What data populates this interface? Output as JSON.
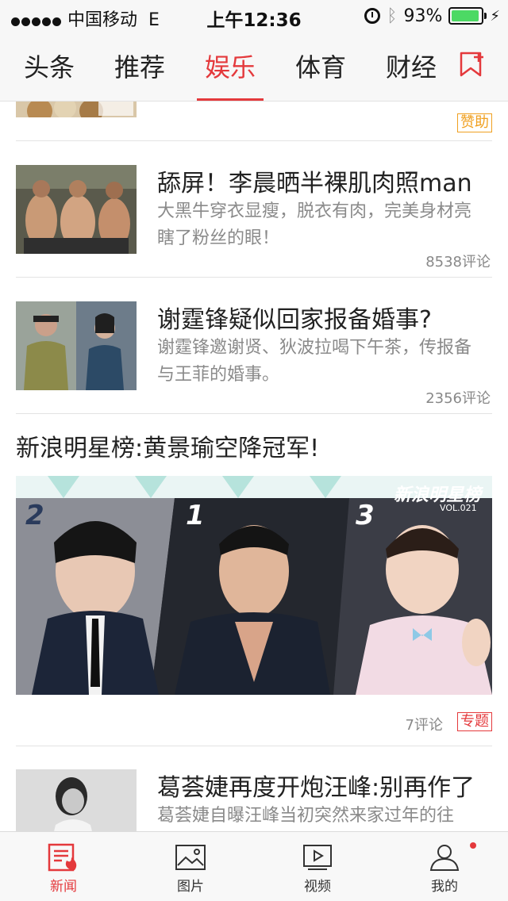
{
  "status_bar": {
    "carrier": "中国移动",
    "network": "E",
    "time": "上午12:36",
    "battery_percent": "93%",
    "battery_level": 0.93,
    "battery_color": "#4cd964"
  },
  "category_tabs": {
    "items": [
      {
        "label": "头条"
      },
      {
        "label": "推荐"
      },
      {
        "label": "娱乐"
      },
      {
        "label": "体育"
      },
      {
        "label": "财经"
      }
    ],
    "active": "娱乐",
    "accent": "#e4393c"
  },
  "feed": {
    "ad_item": {
      "tag": "赞助"
    },
    "news": [
      {
        "title": "舔屏！李晨晒半裸肌肉照man",
        "desc": "大黑牛穿衣显瘦，脱衣有肉，完美身材亮瞎了粉丝的眼！",
        "comments": "8538评论"
      },
      {
        "title": "谢霆锋疑似回家报备婚事?",
        "desc": "谢霆锋邀谢贤、狄波拉喝下午茶，传报备与王菲的婚事。",
        "comments": "2356评论"
      }
    ],
    "feature": {
      "title": "新浪明星榜:黄景瑜空降冠军!",
      "banner_brand": "新浪明星榜",
      "banner_vol": "VOL.021",
      "ranks": [
        "2",
        "1",
        "3"
      ],
      "comments": "7评论",
      "tag": "专题"
    },
    "last_news": {
      "title": "葛荟婕再度开炮汪峰:别再作了",
      "desc": "葛荟婕自曝汪峰当初突然来家过年的往"
    }
  },
  "tab_bar": {
    "items": [
      {
        "label": "新闻",
        "icon": "news-icon"
      },
      {
        "label": "图片",
        "icon": "picture-icon"
      },
      {
        "label": "视频",
        "icon": "video-icon"
      },
      {
        "label": "我的",
        "icon": "profile-icon"
      }
    ],
    "active": "新闻"
  }
}
